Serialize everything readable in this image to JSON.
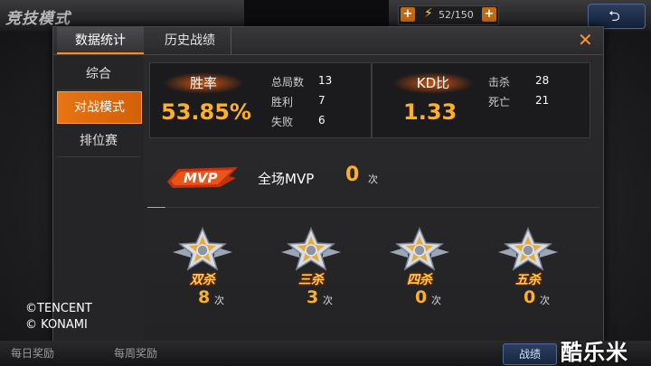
{
  "header": {
    "mode_title": "竞技模式",
    "resource": "52/150",
    "plus_symbol": "+"
  },
  "panel": {
    "tabs": [
      {
        "label": "数据统计",
        "active": true
      },
      {
        "label": "历史战绩",
        "active": false
      }
    ],
    "close_symbol": "✕",
    "sidebar": [
      {
        "label": "综合",
        "active": false
      },
      {
        "label": "对战模式",
        "active": true
      },
      {
        "label": "排位赛",
        "active": false
      }
    ],
    "winrate": {
      "label": "胜率",
      "value": "53.85%",
      "total_label": "总局数",
      "total": "13",
      "wins_label": "胜利",
      "wins": "7",
      "losses_label": "失败",
      "losses": "6"
    },
    "kd": {
      "label": "KD比",
      "value": "1.33",
      "kills_label": "击杀",
      "kills": "28",
      "deaths_label": "死亡",
      "deaths": "21"
    },
    "mvp": {
      "logo_text": "MVP",
      "label": "全场MVP",
      "value": "0",
      "unit": "次"
    },
    "multikills": [
      {
        "name": "双杀",
        "value": "8",
        "unit": "次"
      },
      {
        "name": "三杀",
        "value": "3",
        "unit": "次"
      },
      {
        "name": "四杀",
        "value": "0",
        "unit": "次"
      },
      {
        "name": "五杀",
        "value": "0",
        "unit": "次"
      }
    ]
  },
  "copyright": {
    "line1": "©TENCENT",
    "line2": "© KONAMI"
  },
  "bottom": {
    "daily": "每日奖励",
    "weekly": "每周奖励",
    "battle": "战绩"
  },
  "watermark": "酷乐米",
  "colors": {
    "accent": "#ff8a1e",
    "value": "#ffb028",
    "panel": "#2b2b2e"
  }
}
